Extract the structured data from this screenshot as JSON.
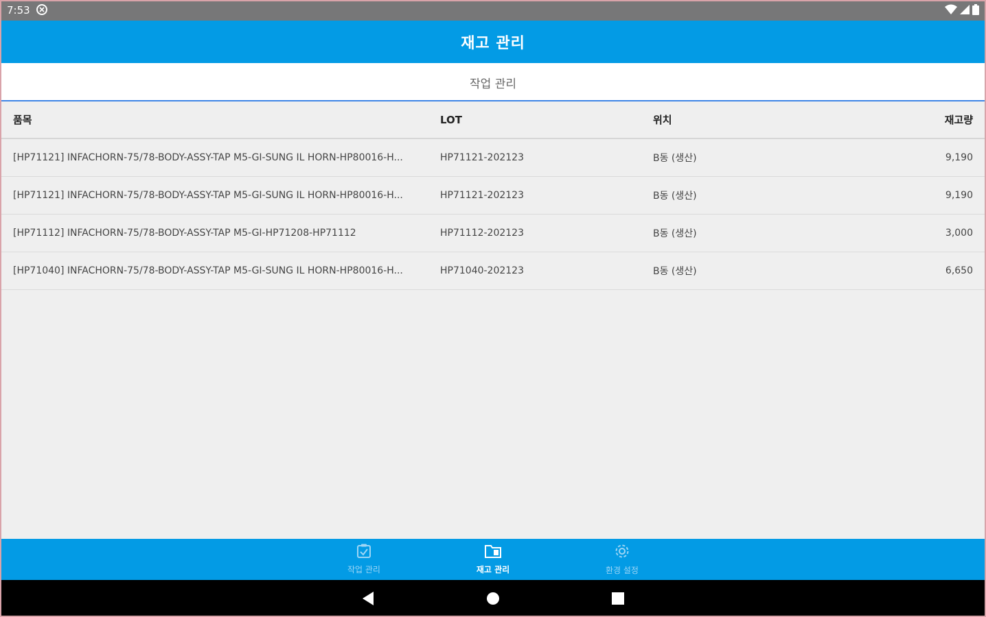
{
  "status_bar": {
    "time": "7:53",
    "icons": [
      "notification-icon",
      "wifi-icon",
      "signal-icon",
      "battery-icon"
    ]
  },
  "app_bar": {
    "title": "재고 관리"
  },
  "tabs": [
    {
      "label": "작업 관리",
      "selected": true
    }
  ],
  "table": {
    "columns": [
      "품목",
      "LOT",
      "위치",
      "재고량"
    ],
    "rows": [
      {
        "item": "[HP71121] INFACHORN-75/78-BODY-ASSY-TAP M5-GI-SUNG IL HORN-HP80016-H...",
        "lot": "HP71121-202123",
        "location": "B동 (생산)",
        "qty": "9,190"
      },
      {
        "item": "[HP71121] INFACHORN-75/78-BODY-ASSY-TAP M5-GI-SUNG IL HORN-HP80016-H...",
        "lot": "HP71121-202123",
        "location": "B동 (생산)",
        "qty": "9,190"
      },
      {
        "item": "[HP71112] INFACHORN-75/78-BODY-ASSY-TAP M5-GI-HP71208-HP71112",
        "lot": "HP71112-202123",
        "location": "B동 (생산)",
        "qty": "3,000"
      },
      {
        "item": "[HP71040] INFACHORN-75/78-BODY-ASSY-TAP M5-GI-SUNG IL HORN-HP80016-H...",
        "lot": "HP71040-202123",
        "location": "B동 (생산)",
        "qty": "6,650"
      }
    ]
  },
  "bottom_nav": [
    {
      "label": "작업 관리",
      "icon": "task-check-icon",
      "active": false
    },
    {
      "label": "재고 관리",
      "icon": "inventory-icon",
      "active": true
    },
    {
      "label": "환경 설정",
      "icon": "gear-icon",
      "active": false
    }
  ],
  "colors": {
    "primary": "#039be5",
    "status_bar": "#777778",
    "background": "#efefef",
    "tab_indicator": "#3d84e6"
  }
}
